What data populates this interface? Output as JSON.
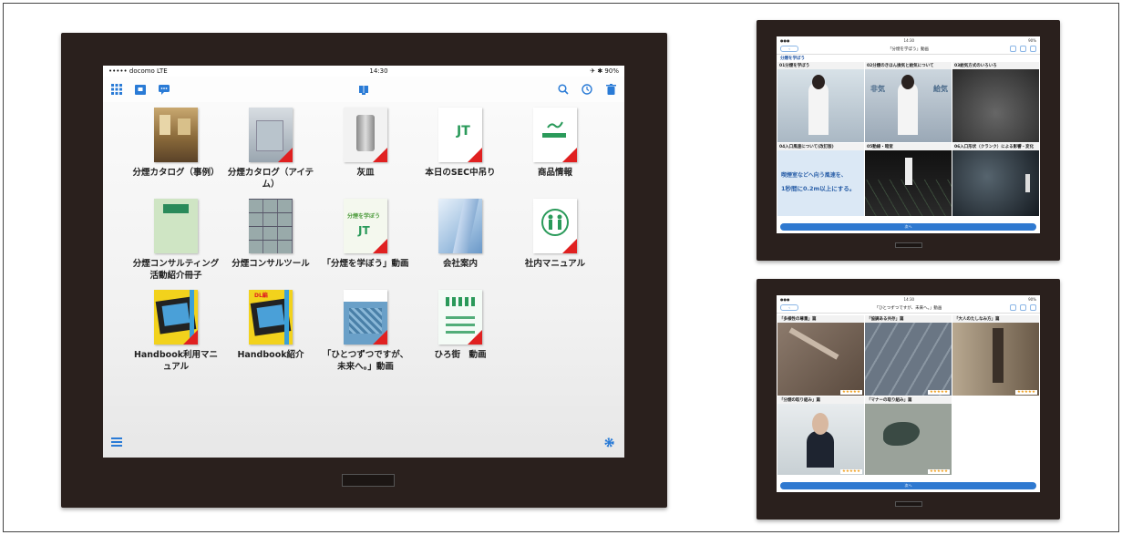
{
  "main": {
    "status": {
      "carrier": "••••• docomo  LTE",
      "time": "14:30",
      "battery": "✈ ✱ 90%"
    },
    "items": [
      {
        "label": "分煙カタログ（事例）",
        "thumb": "photo-interior",
        "download": false
      },
      {
        "label": "分煙カタログ（アイテム）",
        "thumb": "photo-booth",
        "download": true
      },
      {
        "label": "灰皿",
        "thumb": "photo-ashtray",
        "download": true
      },
      {
        "label": "本日のSEC中吊り",
        "thumb": "jt-logo",
        "download": true
      },
      {
        "label": "商品情報",
        "thumb": "cigarette-icon",
        "download": true
      },
      {
        "label": "分煙コンサルティング活動紹介冊子",
        "thumb": "green-booklet",
        "download": false
      },
      {
        "label": "分煙コンサルツール",
        "thumb": "grid-tool",
        "download": false
      },
      {
        "label": "「分煙を学ぼう」動画",
        "thumb": "learn-video",
        "download": true
      },
      {
        "label": "会社案内",
        "thumb": "building",
        "download": false
      },
      {
        "label": "社内マニュアル",
        "thumb": "people-icon",
        "download": true
      },
      {
        "label": "Handbook利用マニュアル",
        "thumb": "film-yellow",
        "download": true
      },
      {
        "label": "Handbook紹介",
        "thumb": "film-yellow-dl",
        "download": false,
        "badge": "DL編"
      },
      {
        "label": "「ひとつずつですが、未来へ。」動画",
        "thumb": "map-blue",
        "download": true
      },
      {
        "label": "ひろ街　動画",
        "thumb": "hiro-town",
        "download": true
      }
    ]
  },
  "small1": {
    "title": "「分煙を学ぼう」動画",
    "section": "分煙を学ぼう",
    "videos": [
      {
        "caption": "01分煙を学ぼう",
        "tone": "#c9d6de"
      },
      {
        "caption": "02分煙のきほん換気と給気について",
        "tone": "#b8c6d2"
      },
      {
        "caption": "03給気方式のいろいろ",
        "tone": "#3a3a3a"
      },
      {
        "caption": "04入口風速について(改訂版)",
        "tone": "#d9e6f4"
      },
      {
        "caption": "05動線・暗室",
        "tone": "#1a1a1a"
      },
      {
        "caption": "06入口形状（クランク）による影響・変化",
        "tone": "#202830"
      }
    ],
    "slide_text_a": "喫煙室などへ向う風速を、",
    "slide_text_b": "1秒間に0.2m以上にする。",
    "foot": "次へ"
  },
  "small2": {
    "title": "「ひとつずつですが、未来へ。」動画",
    "videos": [
      {
        "caption": "「多様性の尊重」篇",
        "tone": "#7a6a5c",
        "stars": "★★★★★"
      },
      {
        "caption": "「協調ある共存」篇",
        "tone": "#6b7784",
        "stars": "★★★★★"
      },
      {
        "caption": "「大人のたしなみ方」篇",
        "tone": "#8c7a6a",
        "stars": "★★★★★"
      },
      {
        "caption": "「分煙の取り組み」篇",
        "tone": "#d8dde0",
        "stars": "★★★★★"
      },
      {
        "caption": "「マナーの取り組み」篇",
        "tone": "#8a8e86",
        "stars": "★★★★★"
      }
    ],
    "foot": "次へ"
  }
}
